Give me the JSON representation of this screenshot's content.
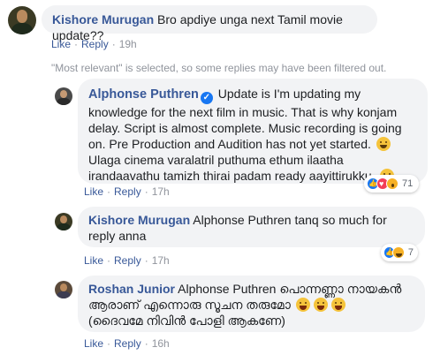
{
  "comments": [
    {
      "author": "Kishore Murugan",
      "text": "Bro apdiye unga next Tamil movie update??",
      "actions": {
        "like": "Like",
        "reply": "Reply",
        "time": "19h"
      }
    }
  ],
  "filter_notice": "\"Most relevant\" is selected, so some replies may have been filtered out.",
  "replies": [
    {
      "author": "Alphonse Puthren",
      "verified": true,
      "text_part1": "Update is I'm updating my knowledge for the next film in music. That is why konjam delay. Script is almost complete. Music recording is going on. Pre Production and Audition has not yet started.",
      "text_part2": "Ulaga cinema varalatril puthuma ethum ilaatha irandaavathu tamizh thirai padam ready aayittirukku.",
      "actions": {
        "like": "Like",
        "reply": "Reply",
        "time": "17h"
      },
      "reactions": {
        "types": [
          "like",
          "love",
          "wow"
        ],
        "count": "71"
      }
    },
    {
      "author": "Kishore Murugan",
      "mention": "Alphonse Puthren",
      "text": "tanq so much for reply anna",
      "actions": {
        "like": "Like",
        "reply": "Reply",
        "time": "17h"
      },
      "reactions": {
        "types": [
          "like",
          "haha"
        ],
        "count": "7"
      }
    },
    {
      "author": "Roshan Junior",
      "mention": "Alphonse Puthren",
      "text_line1": "പൊന്നണ്ണാ നായകൻ",
      "text_line2": "ആരാണ് എന്നൊരു സൂചന തരുമോ",
      "text_line3": "(ദൈവമേ നിവിൻ പോളി ആകണേ)",
      "actions": {
        "like": "Like",
        "reply": "Reply",
        "time": "16h"
      }
    }
  ],
  "colors": {
    "link": "#385898",
    "bubble": "#f2f3f5",
    "meta_gray": "#90949c"
  }
}
